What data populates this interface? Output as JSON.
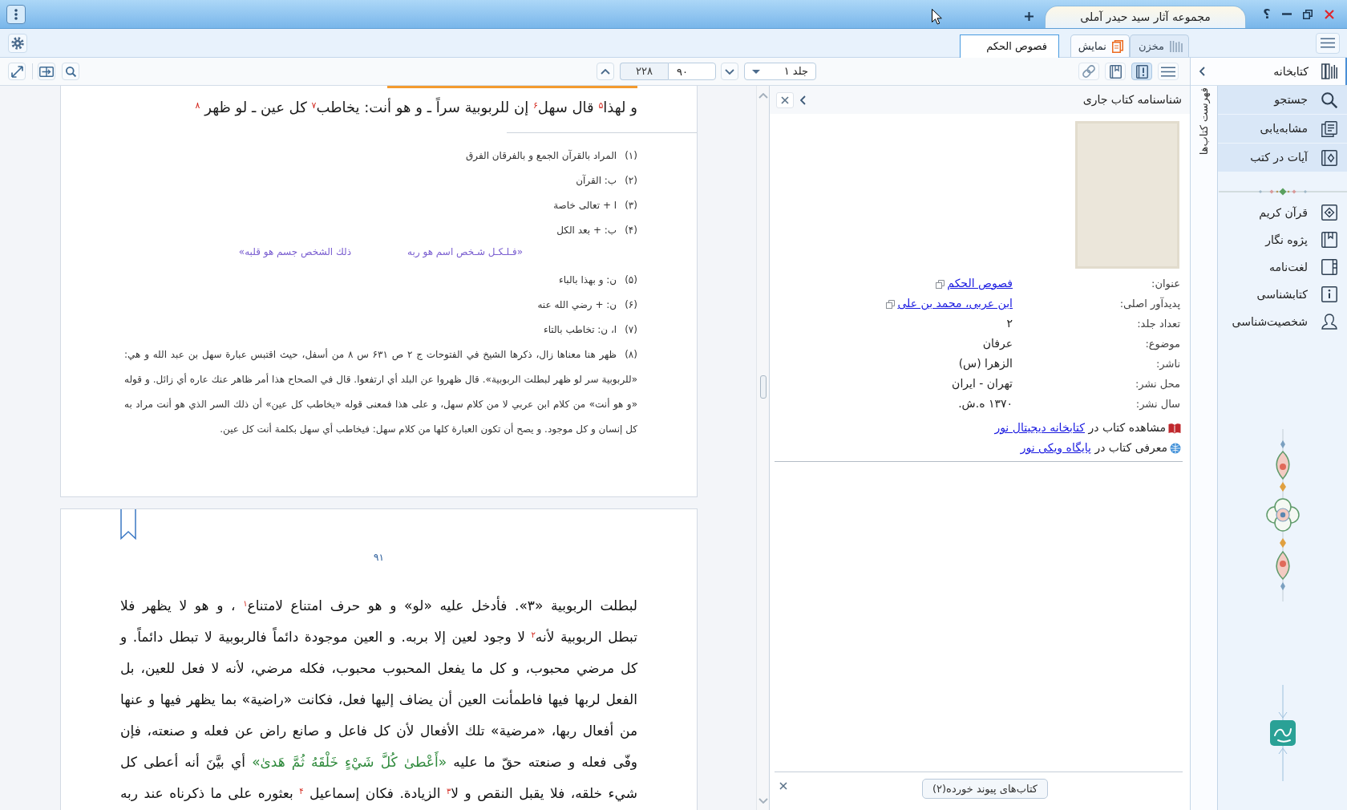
{
  "title_bar": {
    "app_tab": "مجموعه آثار سید حیدر آملی",
    "help": "؟"
  },
  "tab_bar": {
    "document_tabs": [
      {
        "label": "فصوص الحکم",
        "selected": true
      }
    ],
    "mode_tabs": [
      {
        "label": "مخزن",
        "kind": "repository",
        "selected": false
      },
      {
        "label": "نمایش",
        "kind": "display",
        "selected": true
      }
    ]
  },
  "toolbar": {
    "page_count": "۲۲۸",
    "page_field": "۹۰",
    "volume": "جلد ۱",
    "view_buttons": [
      {
        "kind": "link",
        "selected": false
      },
      {
        "kind": "bookmarks",
        "selected": false
      },
      {
        "kind": "info",
        "selected": true
      },
      {
        "kind": "list",
        "selected": false
      }
    ]
  },
  "reader": {
    "upper_page": {
      "heading": "و لهذا$^{۵}$ قال سهل$^{۶}$ إن للربوبية سراً ـ و هو أنت: يخاطب$^{۷}$ كل عين ـ لو ظهر $^{۸}$",
      "footnotes": [
        {
          "kind": "note",
          "number": "(۱)",
          "text": "المراد بالقرآن الجمع و بالفرقان الفرق"
        },
        {
          "kind": "note",
          "number": "(۲)",
          "text": "ب: القرآن"
        },
        {
          "kind": "note",
          "number": "(۳)",
          "text": "ا + تعالى خاصة"
        },
        {
          "kind": "note",
          "number": "(۴)",
          "text": "ب: + بعد الكل"
        },
        {
          "kind": "verse",
          "hemistichs": [
            "«فـلـكـل شـخص اسم هو ربه",
            "ذلك الشخص جسم هو قلبه»"
          ]
        },
        {
          "kind": "note",
          "number": "(۵)",
          "text": "ن: و بهذا بالباء"
        },
        {
          "kind": "note",
          "number": "(۶)",
          "text": "ن: + رضي الله عنه"
        },
        {
          "kind": "note",
          "number": "(۷)",
          "text": "ا، ن: تخاطب بالتاء"
        },
        {
          "kind": "note",
          "number": "(۸)",
          "text": "ظهر هنا معناها زال، ذكرها الشيخ في الفتوحات ج ۲ ص ۶۳۱ س ۸ من أسفل، حيث اقتبس عبارة سهل بن عبد الله و هي: «للربوبية سر لو ظهر لبطلت الربوبية». قال ظهروا عن البلد أي ارتفعوا. قال في الصحاح هذا أمر ظاهر عنك عاره أي زائل. و قوله «و هو أنت» من كلام ابن عربي لا من كلام سهل، و على هذا فمعنى قوله «يخاطب كل عين» أن ذلك السر الذي هو أنت مراد به كل إنسان و كل موجود. و يصح أن تكون العبارة كلها من كلام سهل: فيخاطب أي سهل بكلمة أنت كل عين."
        }
      ]
    },
    "lower_page": {
      "page_number": "۹۱",
      "lines": [
        [
          {
            "kind": "plain",
            "text": "لبطلت الربوبية «۳». فأدخل عليه «لو» و هو حرف امتناع لامتناع$^{۱}$ ، و هو لا يظهر فلا"
          }
        ],
        [
          {
            "kind": "plain",
            "text": "تبطل الربوبية لأنه$^{۲}$ لا وجود لعين إلا بربه. و العين موجودة دائماً فالربوبية لا تبطل دائماً. و"
          }
        ],
        [
          {
            "kind": "plain",
            "text": "كل مرضي محبوب، و كل ما يفعل المحبوب محبوب، فكله مرضي، لأنه لا فعل للعين، بل"
          }
        ],
        [
          {
            "kind": "plain",
            "text": "الفعل لربها فيها فاطمأنت العين أن يضاف إليها فعل، فكانت «راضية» بما يظهر فيها و عنها"
          }
        ],
        [
          {
            "kind": "plain",
            "text": "من أفعال ربها، «مرضية» تلك الأفعال لأن كل فاعل و صانع راض عن فعله و صنعته، فإن"
          }
        ],
        [
          {
            "kind": "plain",
            "text": "وفّى فعله و صنعته حقّ ما عليه "
          },
          {
            "kind": "quran",
            "text": "«أَعْطىٰ كُلَّ شَيْءٍ خَلْقَهُ ثُمَّ هَدىٰ»"
          },
          {
            "kind": "plain",
            "text": " أي بيَّنَ أنه أعطى كل"
          }
        ],
        [
          {
            "kind": "plain",
            "text": "شيء خلقه، فلا يقبل النقص و لا$^{۳}$ الزيادة. فكان إسماعيل $^{۴}$ بعثوره على ما ذكرناه عند ربه"
          }
        ]
      ]
    }
  },
  "book_info": {
    "title": "شناسنامه کتاب جاری",
    "fields": [
      {
        "label": "عنوان:",
        "value": "فصوص الحکم",
        "kind": "link"
      },
      {
        "label": "پدیدآور اصلی:",
        "value": "ابن عربی، محمد بن علی",
        "kind": "link"
      },
      {
        "label": "تعداد جلد:",
        "value": "۲",
        "kind": "text"
      },
      {
        "label": "موضوع:",
        "value": "عرفان",
        "kind": "text"
      },
      {
        "label": "ناشر:",
        "value": "الزهرا (س)",
        "kind": "text"
      },
      {
        "label": "محل نشر:",
        "value": "تهران - ایران",
        "kind": "text"
      },
      {
        "label": "سال نشر:",
        "value": "۱۳۷۰ ه.ش.",
        "kind": "text"
      }
    ],
    "external_links": [
      {
        "kind": "library",
        "prefix": "مشاهده کتاب در",
        "link": "کتابخانه دیجیتال نور"
      },
      {
        "kind": "wiki",
        "prefix": "معرفی کتاب در",
        "link": "پایگاه ویکی نور"
      }
    ],
    "linked_books_button": "کتاب‌های پیوند خورده(۲)"
  },
  "book_list_tab": {
    "label": "فهرست کتاب‌ها"
  },
  "sidebar": {
    "title": "کتابخانه",
    "tools": [
      {
        "label": "جستجو",
        "kind": "search"
      },
      {
        "label": "مشابه‌یابی",
        "kind": "similar"
      },
      {
        "label": "آیات در کتب",
        "kind": "verses"
      }
    ],
    "resources": [
      {
        "label": "قرآن کریم",
        "kind": "quran"
      },
      {
        "label": "پژوه نگار",
        "kind": "research"
      },
      {
        "label": "لغت‌نامه",
        "kind": "dictionary"
      },
      {
        "label": "کتابشناسی",
        "kind": "bibliography"
      },
      {
        "label": "شخصیت‌شناسی",
        "kind": "biography"
      }
    ]
  }
}
